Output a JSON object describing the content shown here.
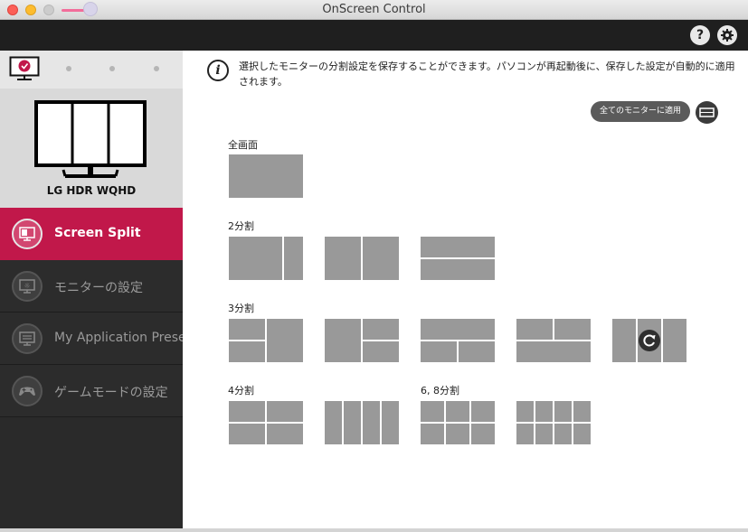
{
  "window": {
    "title": "OnScreen Control"
  },
  "toolbar": {
    "help_label": "?"
  },
  "sidebar": {
    "monitor_name": "LG HDR WQHD",
    "items": [
      {
        "label": "Screen Split",
        "icon": "screen-split-icon",
        "active": true
      },
      {
        "label": "モニターの設定",
        "icon": "monitor-settings-icon",
        "active": false
      },
      {
        "label": "My Application Preset",
        "icon": "app-preset-icon",
        "active": false
      },
      {
        "label": "ゲームモードの設定",
        "icon": "gamepad-icon",
        "active": false
      }
    ]
  },
  "main": {
    "info_text": "選択したモニターの分割設定を保存することができます。パソコンが再起動後に、保存した設定が自動的に適用されます。",
    "apply_all_label": "全てのモニターに適用",
    "sections": {
      "full": "全画面",
      "two": "2分割",
      "three": "3分割",
      "four": "4分割",
      "six_eight": "6, 8分割"
    }
  },
  "colors": {
    "accent": "#c1184a",
    "sidebar": "#2a2a2a",
    "tile": "#999999"
  }
}
